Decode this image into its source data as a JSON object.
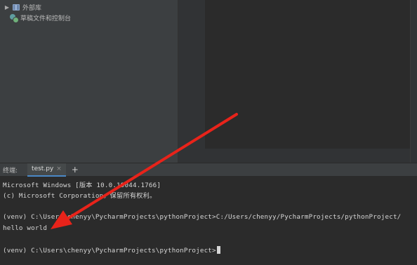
{
  "project_tree": {
    "items": [
      {
        "label": "外部库",
        "icon": "library-icon",
        "expanded": false
      },
      {
        "label": "草稿文件和控制台",
        "icon": "scratches-icon"
      }
    ]
  },
  "terminal_panel": {
    "label": "终端:",
    "tabs": [
      {
        "label": "test.py",
        "active": true
      }
    ],
    "close_glyph": "×",
    "add_glyph": "+"
  },
  "terminal": {
    "lines": [
      "Microsoft Windows [版本 10.0.19044.1766]",
      "(c) Microsoft Corporation。保留所有权利。",
      "(venv) C:\\Users\\chenyy\\PycharmProjects\\pythonProject>C:/Users/chenyy/PycharmProjects/pythonProject/",
      "hello world",
      "(venv) C:\\Users\\chenyy\\PycharmProjects\\pythonProject>"
    ]
  },
  "annotation": {
    "color": "#e8231a"
  },
  "colors": {
    "background": "#2b2b2b",
    "panel": "#3c3f41",
    "tab_underline": "#4a88c7"
  }
}
